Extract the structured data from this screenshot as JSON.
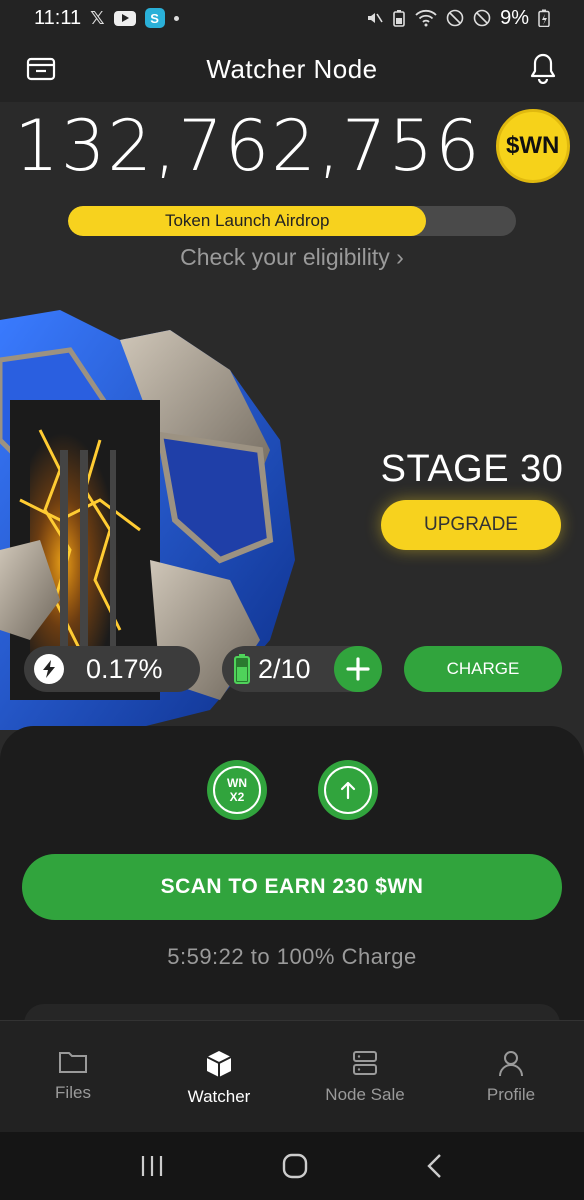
{
  "status_bar": {
    "time": "11:11",
    "battery": "9%",
    "app_icons": [
      "x-icon",
      "youtube-icon",
      "s-app-icon",
      "dot-icon"
    ],
    "system_icons": [
      "mute-icon",
      "battery-saver-icon",
      "wifi-icon",
      "do-not-disturb-icon",
      "block-icon",
      "battery-icon"
    ]
  },
  "header": {
    "title": "Watcher Node",
    "left_icon": "wallet-icon",
    "right_icon": "bell-icon"
  },
  "balance": {
    "amount": "132,762,756",
    "token_badge": "$WN"
  },
  "airdrop": {
    "label": "Token Launch Airdrop",
    "progress": 0.8,
    "fill_color": "#f7d21e"
  },
  "eligibility": {
    "text": "Check your eligibility",
    "chevron": "›"
  },
  "stage": {
    "label": "STAGE 30",
    "upgrade_label": "UPGRADE"
  },
  "stats": {
    "energy_percent": "0.17%",
    "battery_count": "2/10",
    "charge_label": "CHARGE"
  },
  "boosts": {
    "multiplier_line1": "WN",
    "multiplier_line2": "X2",
    "upgrade_icon": "arrow-up-icon"
  },
  "scan": {
    "button_label": "SCAN TO EARN 230 $WN",
    "charge_time": "5:59:22 to 100% Charge"
  },
  "nav": {
    "items": [
      {
        "label": "Files",
        "icon": "folder-icon",
        "active": false
      },
      {
        "label": "Watcher",
        "icon": "cube-icon",
        "active": true
      },
      {
        "label": "Node Sale",
        "icon": "server-icon",
        "active": false
      },
      {
        "label": "Profile",
        "icon": "user-icon",
        "active": false
      }
    ]
  },
  "colors": {
    "accent_yellow": "#f7d21e",
    "accent_green": "#31a43d",
    "background": "#2a2a2a"
  }
}
